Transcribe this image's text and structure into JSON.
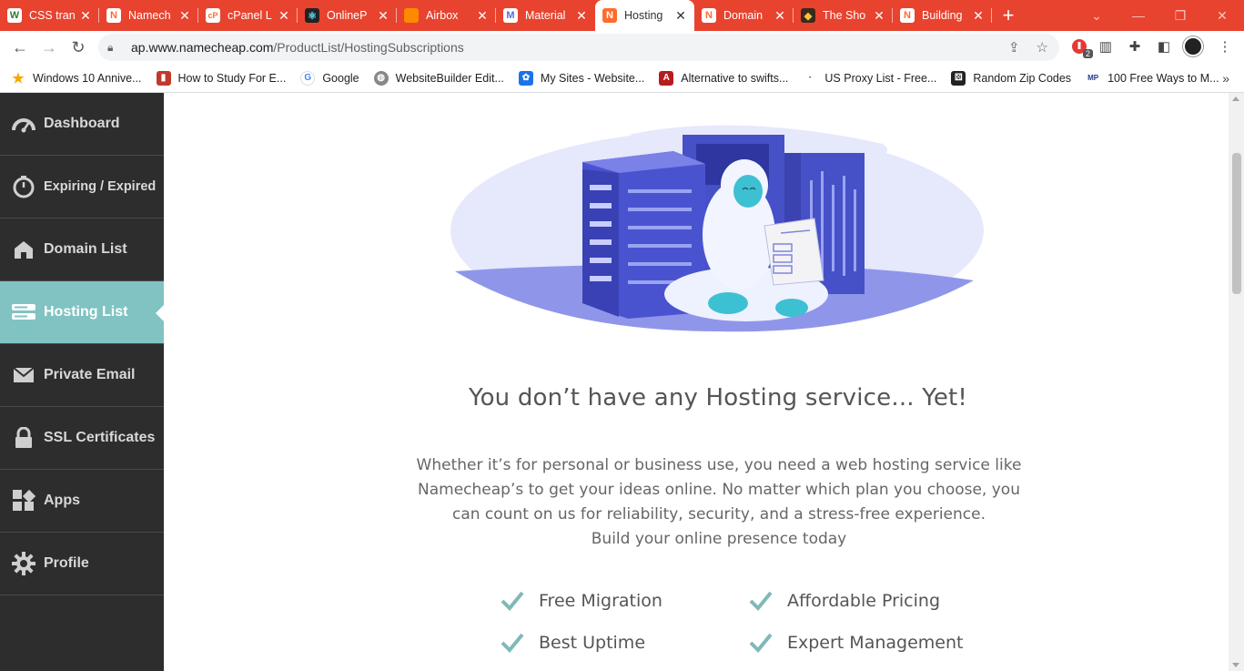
{
  "browser": {
    "tabs": [
      {
        "title": "CSS tran",
        "favicon": "w-icon",
        "color": "#2e7d32",
        "glyph": "W"
      },
      {
        "title": "Namech",
        "favicon": "namecheap-icon",
        "color": "#ff6c2c",
        "glyph": "N"
      },
      {
        "title": "cPanel L",
        "favicon": "cpanel-icon",
        "color": "#ff6c2c",
        "glyph": "cP"
      },
      {
        "title": "OnlineP",
        "favicon": "react-icon",
        "color": "#222222",
        "glyph": "⚛"
      },
      {
        "title": "Airbox",
        "favicon": "airbox-icon",
        "color": "#ff8a00",
        "glyph": "▬"
      },
      {
        "title": "Material",
        "favicon": "material-icon",
        "color": "#5b6bd6",
        "glyph": "M"
      },
      {
        "title": "Hosting",
        "favicon": "namecheap-icon",
        "color": "#ff6c2c",
        "glyph": "N",
        "active": true
      },
      {
        "title": "Domain",
        "favicon": "namecheap-icon",
        "color": "#ff6c2c",
        "glyph": "N"
      },
      {
        "title": "The Sho",
        "favicon": "shop-icon",
        "color": "#3a2a1a",
        "glyph": "◆"
      },
      {
        "title": "Building",
        "favicon": "namecheap-icon",
        "color": "#ff6c2c",
        "glyph": "N"
      }
    ],
    "url_host": "ap.www.namecheap.com",
    "url_path": "/ProductList/HostingSubscriptions",
    "extension_badge": "2",
    "bookmarks": [
      {
        "label": "Windows 10 Annive...",
        "icon": "star-icon",
        "color": "#f6a800",
        "glyph": "★"
      },
      {
        "label": "How to Study For E...",
        "icon": "book-icon",
        "color": "#c0392b",
        "glyph": "▮"
      },
      {
        "label": "Google",
        "icon": "google-icon",
        "color": "#4285f4",
        "glyph": "G"
      },
      {
        "label": "WebsiteBuilder Edit...",
        "icon": "globe-icon",
        "color": "#777777",
        "glyph": "◍"
      },
      {
        "label": "My Sites - Website...",
        "icon": "gear-icon",
        "color": "#1a73e8",
        "glyph": "✿"
      },
      {
        "label": "Alternative to swifts...",
        "icon": "alt-icon",
        "color": "#b71c1c",
        "glyph": "A"
      },
      {
        "label": "US Proxy List - Free...",
        "icon": "proxy-icon",
        "color": "#444444",
        "glyph": "·"
      },
      {
        "label": "Random Zip Codes",
        "icon": "dice-icon",
        "color": "#222222",
        "glyph": "⚄"
      },
      {
        "label": "100 Free Ways to M...",
        "icon": "mp-icon",
        "color": "#1e3a8a",
        "glyph": "MP"
      }
    ]
  },
  "sidebar": {
    "items": [
      {
        "label": "Dashboard",
        "icon": "speedometer-icon"
      },
      {
        "label": "Expiring / Expired",
        "icon": "timer-icon"
      },
      {
        "label": "Domain List",
        "icon": "home-icon"
      },
      {
        "label": "Hosting List",
        "icon": "server-icon",
        "active": true
      },
      {
        "label": "Private Email",
        "icon": "envelope-icon"
      },
      {
        "label": "SSL Certificates",
        "icon": "lock-icon"
      },
      {
        "label": "Apps",
        "icon": "apps-grid-icon"
      },
      {
        "label": "Profile",
        "icon": "gear-icon"
      }
    ]
  },
  "main": {
    "headline": "You don’t have any Hosting service... Yet!",
    "description": [
      "Whether it’s for personal or business use, you need a web hosting service like",
      "Namecheap’s to get your ideas online. No matter which plan you choose, you",
      "can count on us for reliability, security, and a stress-free experience.",
      "Build your online presence today"
    ],
    "features": [
      "Free Migration",
      "Affordable Pricing",
      "Best Uptime",
      "Expert Management"
    ],
    "colors": {
      "accent": "#80c3c2",
      "check": "#7fb9b8",
      "server": "#4650c7",
      "ellipse": "#e6e8fb"
    }
  }
}
